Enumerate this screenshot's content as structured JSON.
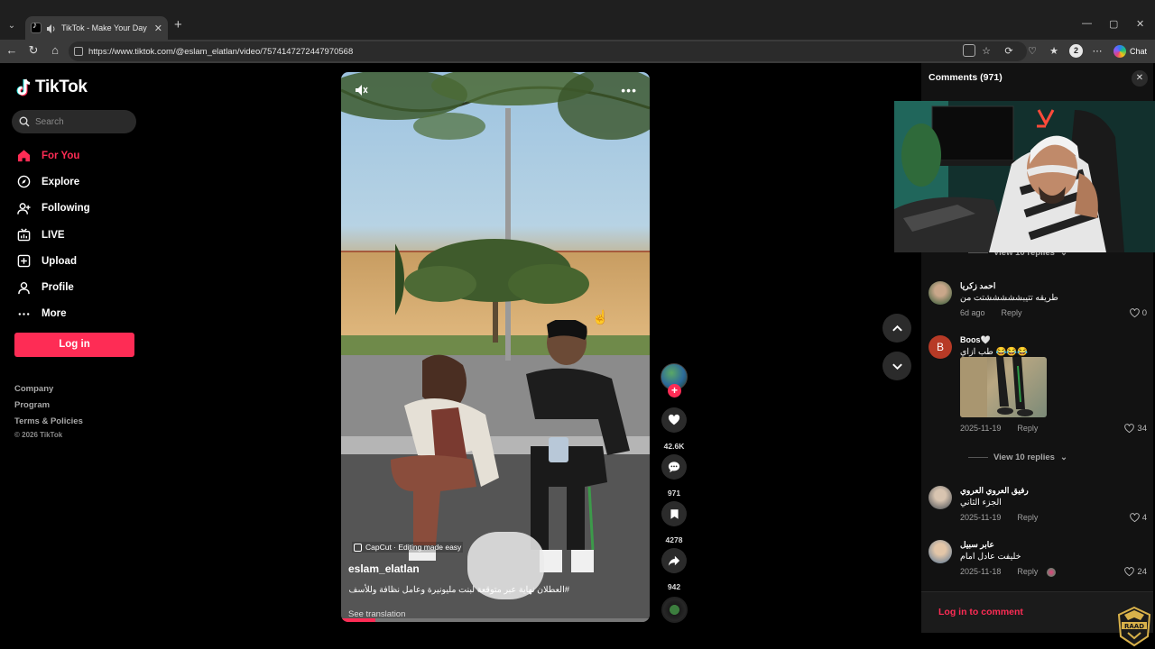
{
  "browser": {
    "tab_title": "TikTok - Make Your Day",
    "url": "https://www.tiktok.com/@eslam_elatlan/video/7574147272447970568",
    "profile_initial": "2",
    "chat_label": "Chat"
  },
  "sidebar": {
    "logo_text": "TikTok",
    "search_placeholder": "Search",
    "nav": [
      {
        "label": "For You",
        "icon": "home-icon",
        "active": true
      },
      {
        "label": "Explore",
        "icon": "compass-icon"
      },
      {
        "label": "Following",
        "icon": "user-plus-icon"
      },
      {
        "label": "LIVE",
        "icon": "live-tv-icon"
      },
      {
        "label": "Upload",
        "icon": "plus-square-icon"
      },
      {
        "label": "Profile",
        "icon": "person-icon"
      },
      {
        "label": "More",
        "icon": "ellipsis-icon"
      }
    ],
    "login_label": "Log in",
    "footer": [
      "Company",
      "Program",
      "Terms & Policies"
    ],
    "copyright": "© 2026 TikTok"
  },
  "video": {
    "capcut_label": "CapCut · Editing made easy",
    "author": "eslam_elatlan",
    "caption": "#العطلان نهاية عبر متوقعة لبنت مليونيرة وعامل نظافة وللأسف",
    "see_translation": "See translation",
    "progress_fraction": 0.11
  },
  "actions": {
    "likes": "42.6K",
    "comments": "971",
    "saves": "4278",
    "shares": "942"
  },
  "comments_panel": {
    "header": "Comments (971)",
    "view_replies_top": "View 10 replies",
    "items": [
      {
        "name": "احمد زكريا",
        "text": "طريقه تتيبشششششتت من",
        "date": "6d ago",
        "reply": "Reply",
        "likes": "0"
      },
      {
        "name": "Boos🤍",
        "text": "طب ازاي 😂😂😂",
        "date": "2025-11-19",
        "reply": "Reply",
        "likes": "34",
        "avatar_letter": "B"
      },
      {
        "name": "رفيق العروي العروي",
        "text": "الجزء الثاني",
        "date": "2025-11-19",
        "reply": "Reply",
        "likes": "4"
      },
      {
        "name": "عابر سبيل",
        "text": "خليفت عادل امام",
        "date": "2025-11-18",
        "reply": "Reply",
        "likes": "24"
      }
    ],
    "view_replies_mid": "View 10 replies",
    "login_prompt": "Log in to comment"
  },
  "colors": {
    "accent": "#fe2c55",
    "background": "#000000",
    "panel": "#121212"
  }
}
